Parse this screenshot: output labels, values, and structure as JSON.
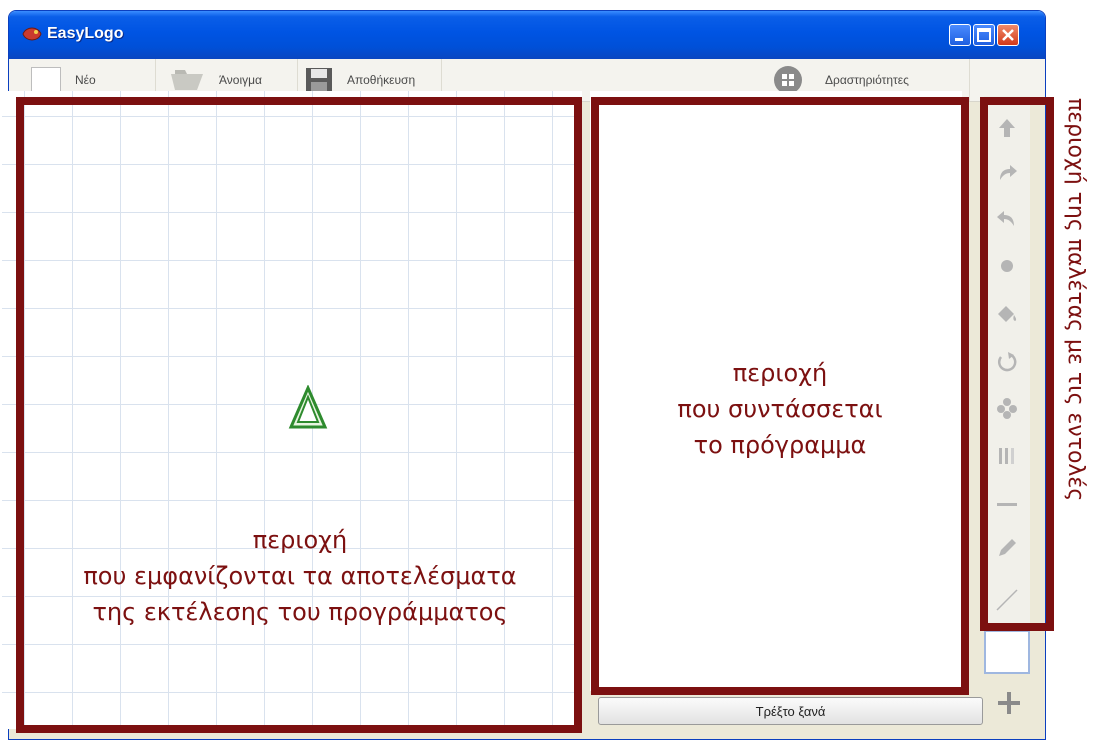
{
  "window": {
    "title": "EasyLogo"
  },
  "toolbar": {
    "new_label": "Νέο",
    "open_label": "Άνοιγμα",
    "save_label": "Αποθήκευση",
    "activities_label": "Δραστηριότητες"
  },
  "buttons": {
    "run_again_label": "Τρέξτο ξανά"
  },
  "annotations": {
    "canvas": [
      "περιοχή",
      "που εμφανίζονται τα αποτελέσματα",
      "της εκτέλεσης του προγράμματος"
    ],
    "program": [
      "περιοχή",
      "που συντάσσεται",
      "το πρόγραμμα"
    ],
    "palette": "περιοχή της παλέτας με τις εντολές"
  },
  "colors": {
    "annotation": "#7c1010",
    "titlebar": "#0054e3",
    "turtle": "#2e8b2e"
  },
  "icons": {
    "palette": [
      "arrow-up-icon",
      "turn-right-icon",
      "turn-left-icon",
      "dot-icon",
      "paint-bucket-icon",
      "repeat-icon",
      "flower-icon",
      "pattern-icon",
      "line-icon",
      "pen-icon",
      "diagonal-icon"
    ]
  }
}
